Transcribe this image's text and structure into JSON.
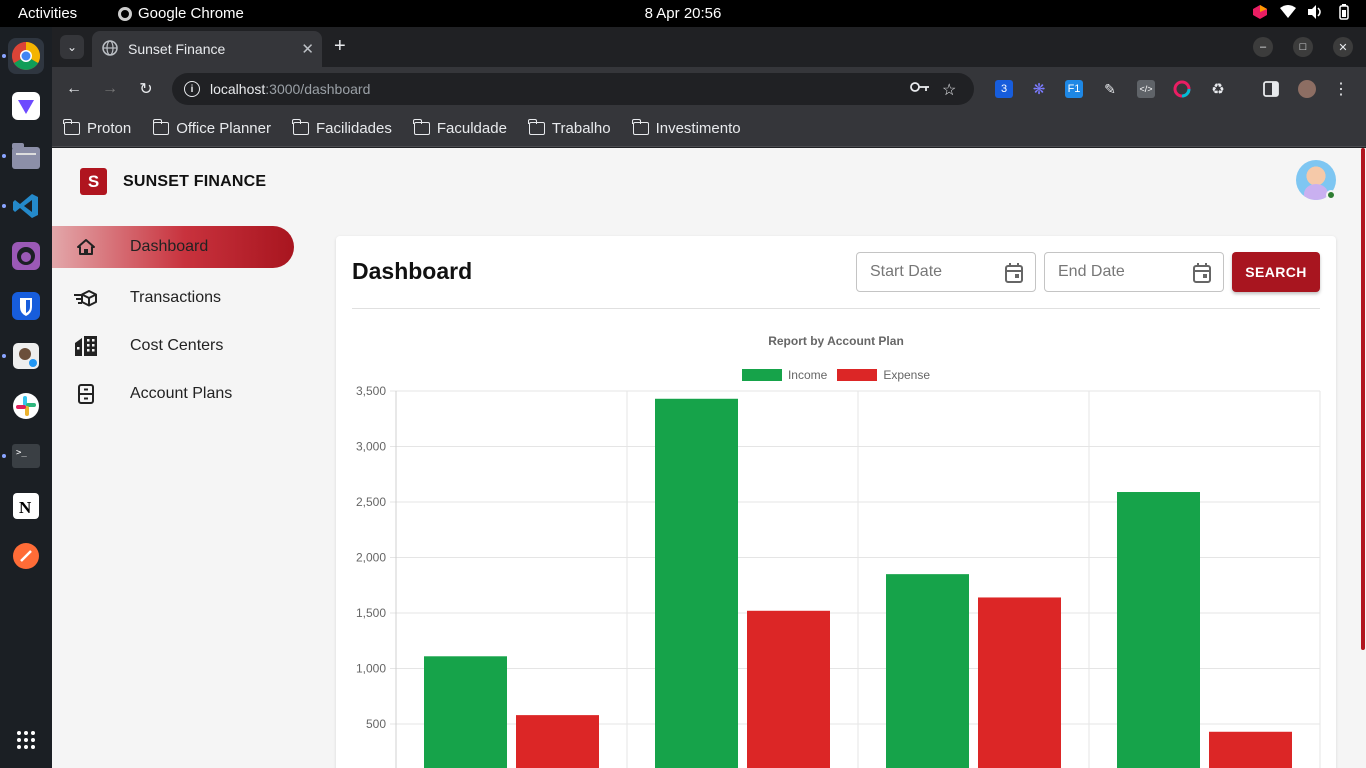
{
  "os": {
    "activities": "Activities",
    "app_name": "Google Chrome",
    "clock": "8 Apr  20:56"
  },
  "browser": {
    "tab_title": "Sunset Finance",
    "url_host": "localhost",
    "url_path": ":3000/dashboard",
    "bookmarks": [
      "Proton",
      "Office Planner",
      "Facilidades",
      "Faculdade",
      "Trabalho",
      "Investimento"
    ]
  },
  "app": {
    "brand": "SUNSET FINANCE",
    "logo_letter": "S",
    "nav": [
      {
        "label": "Dashboard",
        "icon": "home-icon",
        "active": true
      },
      {
        "label": "Transactions",
        "icon": "delivery-box-icon",
        "active": false
      },
      {
        "label": "Cost Centers",
        "icon": "building-icon",
        "active": false
      },
      {
        "label": "Account Plans",
        "icon": "cabinet-icon",
        "active": false
      }
    ],
    "page_title": "Dashboard",
    "start_date_placeholder": "Start Date",
    "end_date_placeholder": "End Date",
    "search_label": "SEARCH",
    "colors": {
      "accent": "#a8151f",
      "income": "#16a34a",
      "expense": "#dc2626"
    }
  },
  "chart_data": {
    "type": "bar",
    "title": "Report by Account Plan",
    "categories": [
      "",
      "",
      "",
      ""
    ],
    "series": [
      {
        "name": "Income",
        "color": "#16a34a",
        "values": [
          1110,
          3430,
          1850,
          2590
        ]
      },
      {
        "name": "Expense",
        "color": "#dc2626",
        "values": [
          580,
          1520,
          1640,
          430
        ]
      }
    ],
    "yticks": [
      "3,500",
      "3,000",
      "2,500",
      "2,000",
      "1,500",
      "1,000",
      "500"
    ],
    "ytick_values": [
      3500,
      3000,
      2500,
      2000,
      1500,
      1000,
      500
    ],
    "ylim": [
      0,
      3500
    ],
    "grid": true,
    "legend": "top-center"
  }
}
